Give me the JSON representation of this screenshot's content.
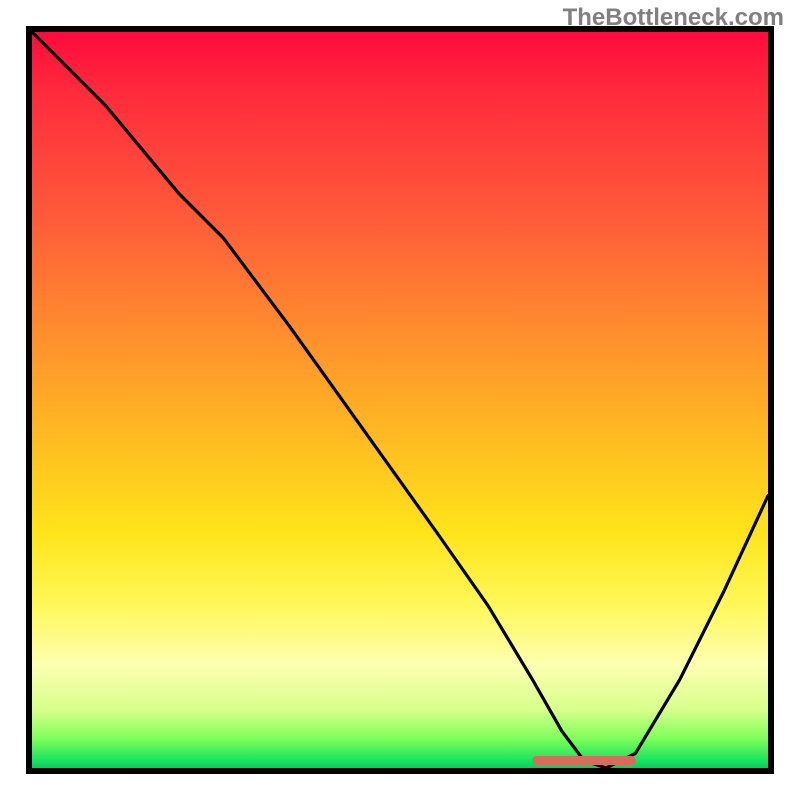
{
  "watermark": "TheBottleneck.com",
  "chart_data": {
    "type": "line",
    "title": "",
    "xlabel": "",
    "ylabel": "",
    "xlim": [
      0,
      100
    ],
    "ylim": [
      0,
      100
    ],
    "x": [
      0,
      5,
      10,
      15,
      20,
      26,
      35,
      45,
      55,
      62,
      68,
      72,
      75,
      78,
      82,
      88,
      94,
      100
    ],
    "values": [
      100,
      95,
      90,
      84,
      78,
      72,
      60,
      46,
      32,
      22,
      12,
      5,
      1,
      0,
      2,
      12,
      24,
      37
    ],
    "background_gradient": [
      "#ff0a3c",
      "#ff8b2e",
      "#ffe41a",
      "#fdffb0",
      "#17e35e"
    ],
    "minimum_marker": {
      "x_start": 68,
      "x_end": 82,
      "y": 0,
      "color": "#d96b5c"
    }
  }
}
